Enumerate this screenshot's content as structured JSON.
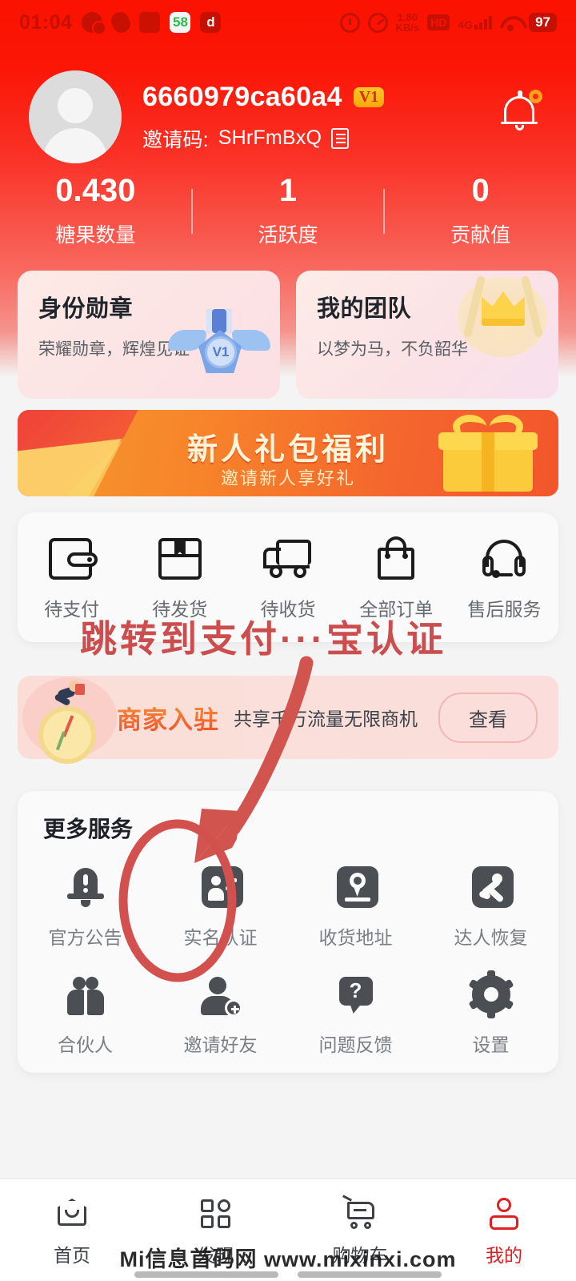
{
  "status_bar": {
    "time": "01:04",
    "app_icons": [
      "wechat-icon",
      "oval-app-icon",
      "alarm-app-icon",
      "58-app-icon",
      "douyin-app-icon"
    ],
    "icon_58_label": "58",
    "icon_dy_label": "d",
    "net_speed_value": "1.80",
    "net_speed_unit": "KB/s",
    "hd_label": "HD",
    "network_label": "4G",
    "battery": "97"
  },
  "header": {
    "username": "6660979ca60a4",
    "level_badge": "V1",
    "invite_label": "邀请码:",
    "invite_code": "SHrFmBxQ",
    "stats": [
      {
        "value": "0.430",
        "label": "糖果数量"
      },
      {
        "value": "1",
        "label": "活跃度"
      },
      {
        "value": "0",
        "label": "贡献值"
      }
    ]
  },
  "duo_cards": [
    {
      "title": "身份勋章",
      "subtitle": "荣耀勋章，辉煌见证",
      "badge": "V1"
    },
    {
      "title": "我的团队",
      "subtitle": "以梦为马，不负韶华"
    }
  ],
  "gift_banner": {
    "title": "新人礼包福利",
    "subtitle": "邀请新人享好礼"
  },
  "orders": {
    "items": [
      {
        "label": "待支付",
        "icon": "wallet-icon"
      },
      {
        "label": "待发货",
        "icon": "box-icon"
      },
      {
        "label": "待收货",
        "icon": "truck-icon"
      },
      {
        "label": "全部订单",
        "icon": "shopping-bag-icon"
      },
      {
        "label": "售后服务",
        "icon": "headset-icon"
      }
    ]
  },
  "merchant_banner": {
    "title": "商家入驻",
    "subtitle": "共享千万流量无限商机",
    "button": "查看"
  },
  "more_services": {
    "title": "更多服务",
    "items": [
      {
        "label": "官方公告",
        "icon": "bell-icon"
      },
      {
        "label": "实名认证",
        "icon": "id-card-icon"
      },
      {
        "label": "收货地址",
        "icon": "location-pin-icon"
      },
      {
        "label": "达人恢复",
        "icon": "runner-icon"
      },
      {
        "label": "合伙人",
        "icon": "partners-icon"
      },
      {
        "label": "邀请好友",
        "icon": "add-friend-icon"
      },
      {
        "label": "问题反馈",
        "icon": "question-bubble-icon"
      },
      {
        "label": "设置",
        "icon": "gear-icon"
      }
    ]
  },
  "annotation": {
    "text": "跳转到支付···宝认证",
    "color": "#cc4d4d",
    "arrow": "points from annotation text down-left to 实名认证",
    "highlight": "ellipse around 实名认证"
  },
  "bottom_nav": {
    "items": [
      {
        "label": "首页",
        "icon": "home-icon",
        "active": false
      },
      {
        "label": "发现",
        "icon": "discover-grid-icon",
        "active": false
      },
      {
        "label": "购物车",
        "icon": "cart-icon",
        "active": false
      },
      {
        "label": "我的",
        "icon": "person-icon",
        "active": true
      }
    ],
    "active_color": "#e02020"
  },
  "watermark": "Mi信息首码网 www.mixinxi.com"
}
